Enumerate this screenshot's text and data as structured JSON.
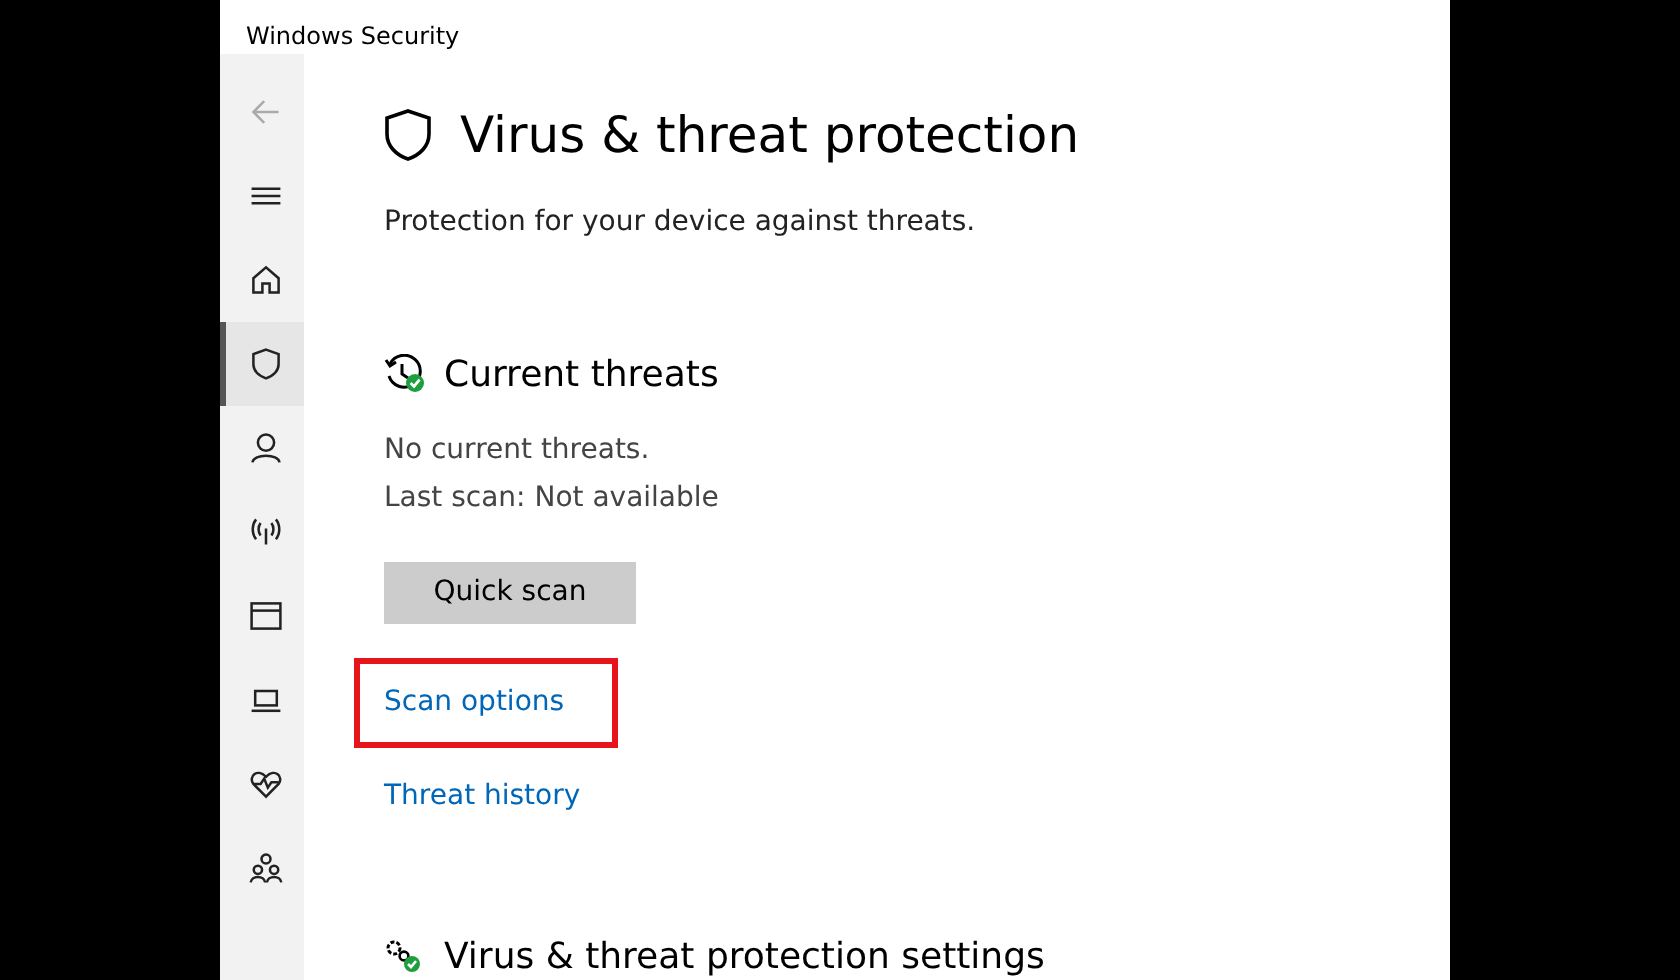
{
  "window": {
    "title": "Windows Security"
  },
  "nav": [
    {
      "kind": "back",
      "selected": false
    },
    {
      "kind": "menu",
      "selected": false
    },
    {
      "kind": "home",
      "selected": false
    },
    {
      "kind": "shield",
      "selected": true
    },
    {
      "kind": "person",
      "selected": false
    },
    {
      "kind": "wireless",
      "selected": false
    },
    {
      "kind": "window",
      "selected": false
    },
    {
      "kind": "laptop",
      "selected": false
    },
    {
      "kind": "heart",
      "selected": false
    },
    {
      "kind": "family",
      "selected": false
    }
  ],
  "page": {
    "title": "Virus & threat protection",
    "subtitle": "Protection for your device against threats."
  },
  "current_threats": {
    "heading": "Current threats",
    "lines": [
      "No current threats.",
      "Last scan: Not available"
    ],
    "button": "Quick scan",
    "links": [
      {
        "label": "Scan options",
        "highlighted": true
      },
      {
        "label": "Threat history",
        "highlighted": false
      }
    ]
  },
  "settings": {
    "heading": "Virus & threat protection settings"
  }
}
